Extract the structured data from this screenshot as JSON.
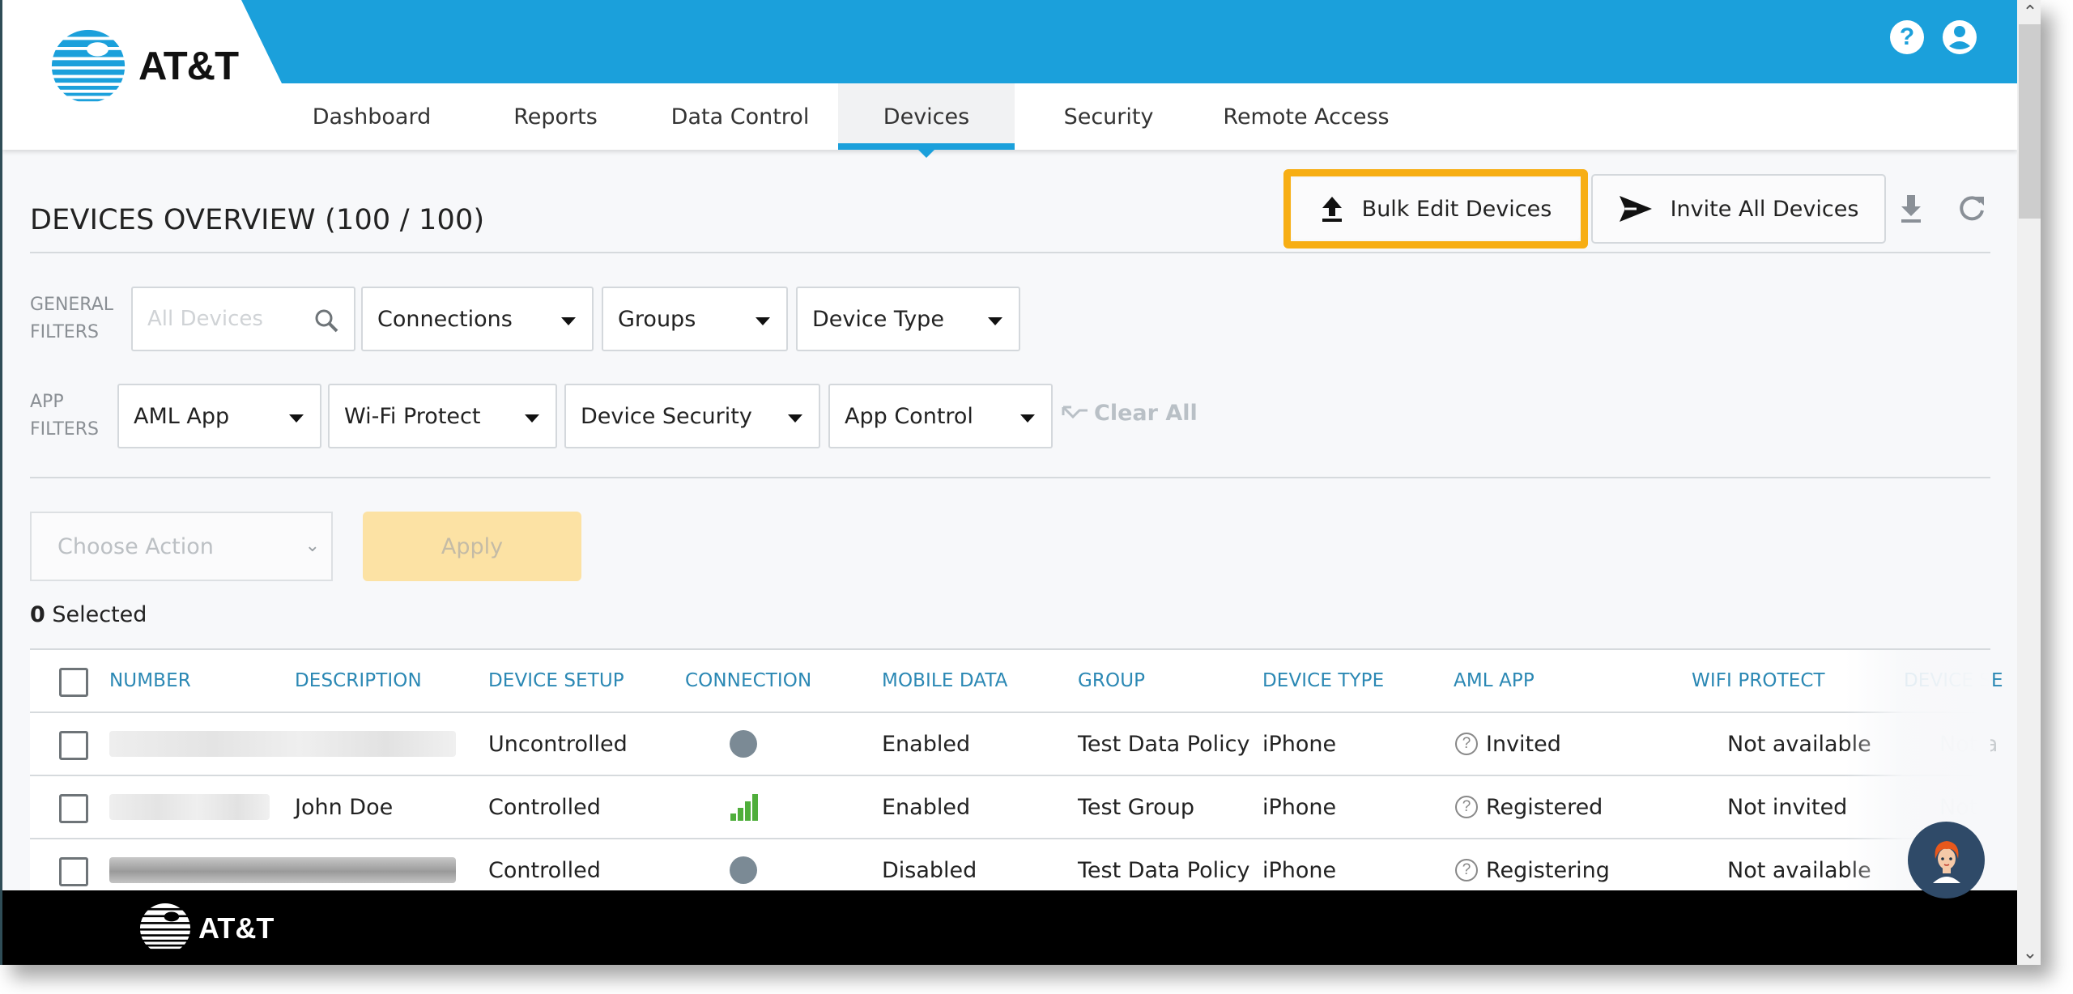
{
  "brand": {
    "name": "AT&T",
    "accent": "#1ba0db",
    "highlight": "#f7ae14"
  },
  "header": {
    "help_icon": "question-circle-icon",
    "user_icon": "user-circle-icon",
    "nav": [
      {
        "label": "Dashboard",
        "active": false
      },
      {
        "label": "Reports",
        "active": false
      },
      {
        "label": "Data Control",
        "active": false
      },
      {
        "label": "Devices",
        "active": true
      },
      {
        "label": "Security",
        "active": false
      },
      {
        "label": "Remote Access",
        "active": false
      }
    ]
  },
  "page": {
    "title": "DEVICES OVERVIEW (100 / 100)",
    "buttons": {
      "bulk_edit": "Bulk Edit Devices",
      "invite_all": "Invite All Devices"
    },
    "tool_icons": [
      "download-icon",
      "refresh-icon"
    ]
  },
  "filters": {
    "general_label_1": "GENERAL",
    "general_label_2": "FILTERS",
    "search_placeholder": "All Devices",
    "general": [
      "Connections",
      "Groups",
      "Device Type"
    ],
    "app_label_1": "APP",
    "app_label_2": "FILTERS",
    "app": [
      "AML App",
      "Wi-Fi Protect",
      "Device Security",
      "App Control"
    ],
    "clear_all": "Clear All"
  },
  "actions": {
    "choose_placeholder": "Choose Action",
    "apply": "Apply",
    "selected_count": "0",
    "selected_label": " Selected"
  },
  "table": {
    "columns": [
      "NUMBER",
      "DESCRIPTION",
      "DEVICE SETUP",
      "CONNECTION",
      "MOBILE DATA",
      "GROUP",
      "DEVICE TYPE",
      "AML APP",
      "WIFI PROTECT",
      "DEVICE SE"
    ],
    "rows": [
      {
        "number": "[redacted]",
        "description": "",
        "device_setup": "Uncontrolled",
        "connection": "offline",
        "mobile_data": "Enabled",
        "group": "Test Data Policy",
        "device_type": "iPhone",
        "aml_app": "Invited",
        "wifi_protect": "Not available",
        "device_security": "Not a"
      },
      {
        "number": "[redacted]",
        "description": "John Doe",
        "device_setup": "Controlled",
        "connection": "signal-strong",
        "mobile_data": "Enabled",
        "group": "Test Group",
        "device_type": "iPhone",
        "aml_app": "Registered",
        "wifi_protect": "Not invited",
        "device_security": "Not i"
      },
      {
        "number": "[redacted]",
        "description": "",
        "device_setup": "Controlled",
        "connection": "offline",
        "mobile_data": "Disabled",
        "group": "Test Data Policy",
        "device_type": "iPhone",
        "aml_app": "Registering",
        "wifi_protect": "Not available",
        "device_security": ""
      }
    ]
  },
  "footer": {
    "brand": "AT&T"
  },
  "chat": {
    "icon": "chat-assistant-avatar-icon"
  }
}
